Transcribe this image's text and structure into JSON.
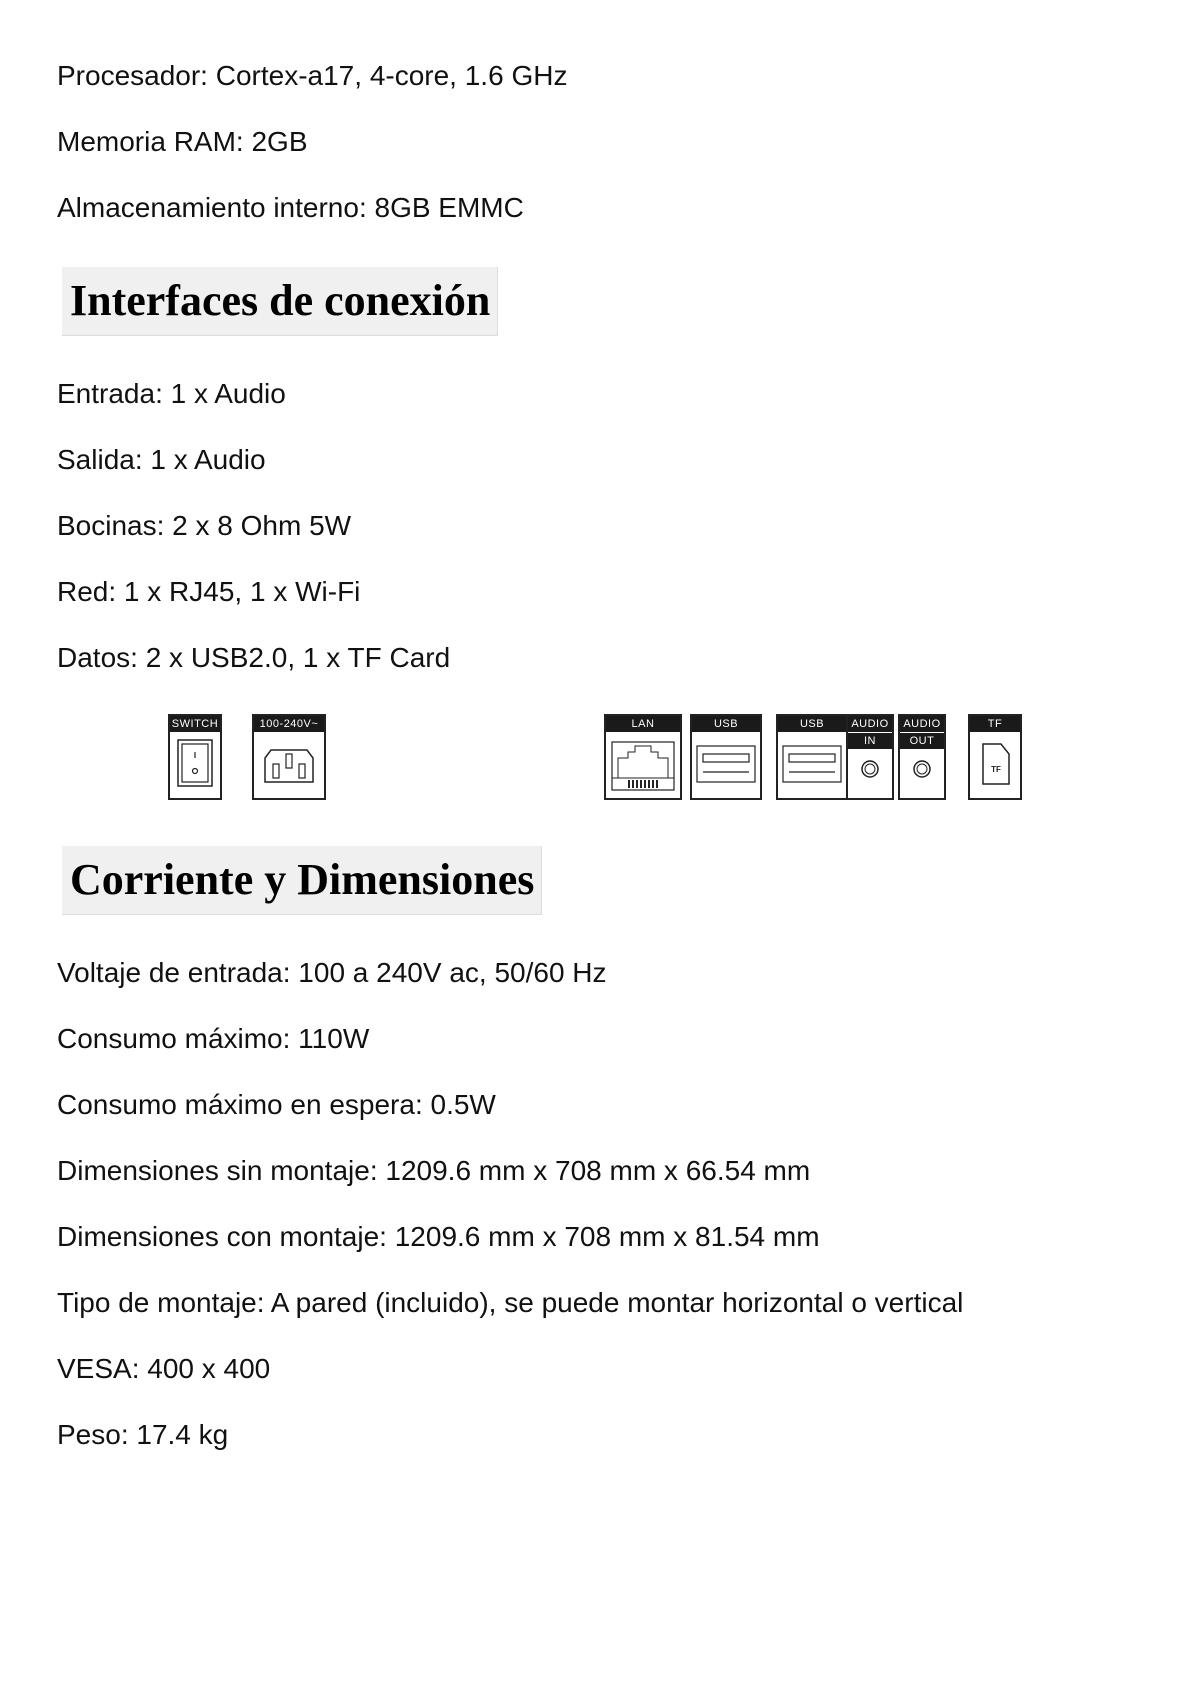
{
  "specs_top": [
    "Procesador: Cortex-a17, 4-core, 1.6 GHz",
    "Memoria RAM: 2GB",
    "Almacenamiento interno: 8GB EMMC"
  ],
  "interfaces": {
    "heading": "Interfaces de conexión",
    "items": [
      "Entrada: 1 x Audio",
      "Salida: 1 x Audio",
      "Bocinas: 2 x 8 Ohm 5W",
      "Red: 1 x RJ45, 1 x Wi-Fi",
      "Datos: 2 x USB2.0, 1 x TF Card"
    ],
    "ports": {
      "switch": "SWITCH",
      "power": "100-240V~",
      "lan": "LAN",
      "usb1": "USB",
      "usb2": "USB",
      "audio_in": [
        "AUDIO",
        "IN"
      ],
      "audio_out": [
        "AUDIO",
        "OUT"
      ],
      "tf": "TF",
      "tf_card_text": "TF"
    }
  },
  "power": {
    "heading": "Corriente y Dimensiones",
    "items": [
      "Voltaje de entrada: 100 a 240V ac, 50/60 Hz",
      "Consumo máximo: 110W",
      "Consumo máximo en espera: 0.5W",
      "Dimensiones sin montaje: 1209.6 mm x 708 mm x 66.54 mm",
      "Dimensiones con montaje: 1209.6 mm x 708 mm x 81.54 mm",
      "Tipo de montaje: A pared (incluido), se puede montar horizontal o vertical",
      "VESA: 400 x 400",
      "Peso: 17.4 kg"
    ]
  }
}
